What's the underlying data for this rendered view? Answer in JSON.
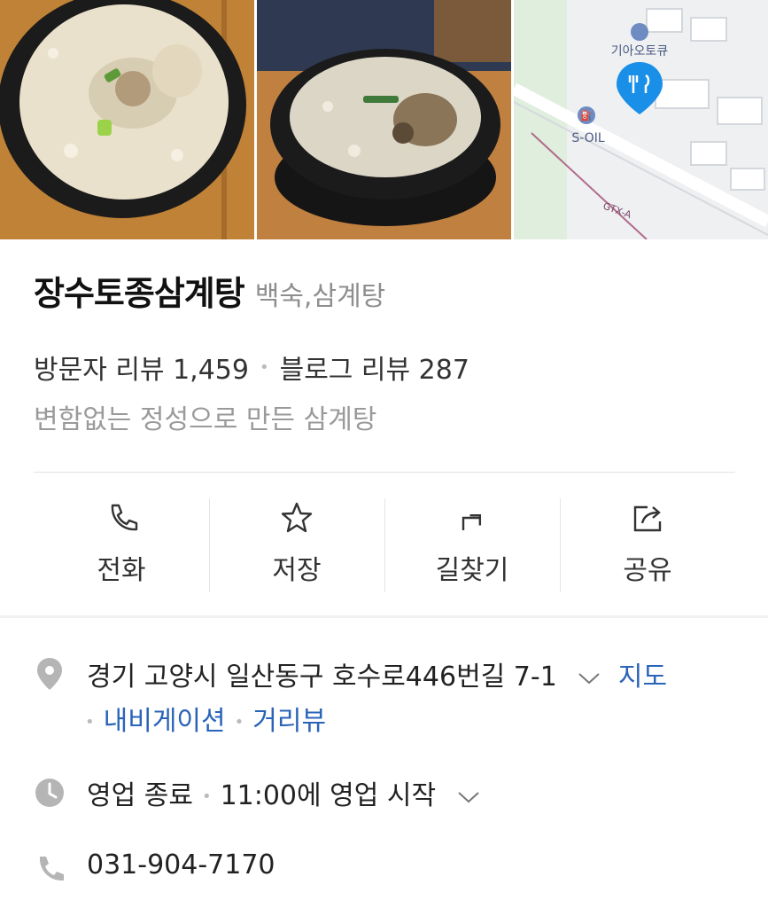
{
  "gallery": {
    "map_labels": {
      "poi": "기아오토큐",
      "gas": "S-OIL",
      "rail": "GTX-A"
    }
  },
  "place": {
    "name": "장수토종삼계탕",
    "category": "백숙,삼계탕",
    "visitor_reviews": "방문자 리뷰 1,459",
    "blog_reviews": "블로그 리뷰 287",
    "description": "변함없는 정성으로 만든 삼계탕"
  },
  "actions": [
    {
      "label": "전화",
      "icon": "phone-icon"
    },
    {
      "label": "저장",
      "icon": "star-icon"
    },
    {
      "label": "길찾기",
      "icon": "directions-icon"
    },
    {
      "label": "공유",
      "icon": "share-icon"
    }
  ],
  "details": {
    "address": "경기 고양시 일산동구 호수로446번길 7-1",
    "map_link": "지도",
    "navigation_link": "내비게이션",
    "street_view_link": "거리뷰",
    "hours_status": "영업 종료",
    "hours_next": "11:00에 영업 시작",
    "phone": "031-904-7170"
  },
  "colors": {
    "link": "#2a64b8",
    "map_pin": "#1a8fe8",
    "muted": "#9a9a9a"
  }
}
